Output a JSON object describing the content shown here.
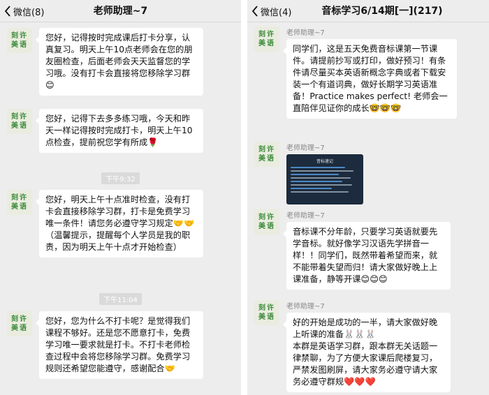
{
  "left": {
    "back_label": "微信(8)",
    "title": "老师助理~7",
    "messages": [
      {
        "text": "您好，记得按时完成课后打卡分享，认真复习。明天上午10点老师会在您的朋友圈检查，后面老师会天天监督您的学习哦。没有打卡会直接将您移除学习群😊"
      },
      {
        "text": "您好，记得下去多多练习哦，今天和昨天一样记得按时完成打卡，明天上午10点检查，提前祝您学有所成🌹"
      },
      {
        "text": "您好，明天上午十点准时检查，没有打卡会直接移除学习群，打卡是免费学习唯一条件！请您务必遵守学习规定🤝🤝（温馨提示，提醒每个人学员是我的职责，因为明天上午十点才开始检查）"
      },
      {
        "text": "您好，您为什么不打卡呢？是觉得我们课程不够好。还是您不愿意打卡，免费学习唯一要求就是打卡。不打卡老师检查过程中会将您移除学习群。免费学习规则还希望您能遵守，感谢配合🤝"
      }
    ],
    "times": [
      "下午9:32",
      "下午11:04"
    ]
  },
  "right": {
    "back_label": "微信(4)",
    "title": "音标学习6/14期[一](217)",
    "sender": "老师助理~7",
    "messages": [
      {
        "text": "同学们，这是五天免费音标课第一节课件。请提前抄写或打印，做好预习！有条件请尽量买本英语新概念字典或者下载安装一个有道词典，做好长期学习英语准备！Practice makes perfect! 老师会一直陪伴见证你的成长🤓🤓🤓"
      },
      {
        "text": "音标课不分年龄，只要学习英语就要先学音标。就好像学习汉语先学拼音一样！！同学们，既然带着希望而来，就不能带着失望而归！请大家做好晚上上课准备，静等开课😊😊😊"
      },
      {
        "text": "好的开始是成功的一半，请大家做好晚上听课的准备🐰🐰🐰\n本群是英语学习群，跟本群无关话题一律禁聊，为了方便大家课后爬楼复习，严禁发图刷屏，请大家务必遵守请大家务必遵守群规❤️❤️❤️"
      }
    ],
    "image_title": "音标速记"
  },
  "avatar_text": [
    "刻许",
    "美语"
  ],
  "colors": {
    "bg": "#ededed",
    "bubble": "#ffffff",
    "avatar_text": "#3c8a3a"
  }
}
